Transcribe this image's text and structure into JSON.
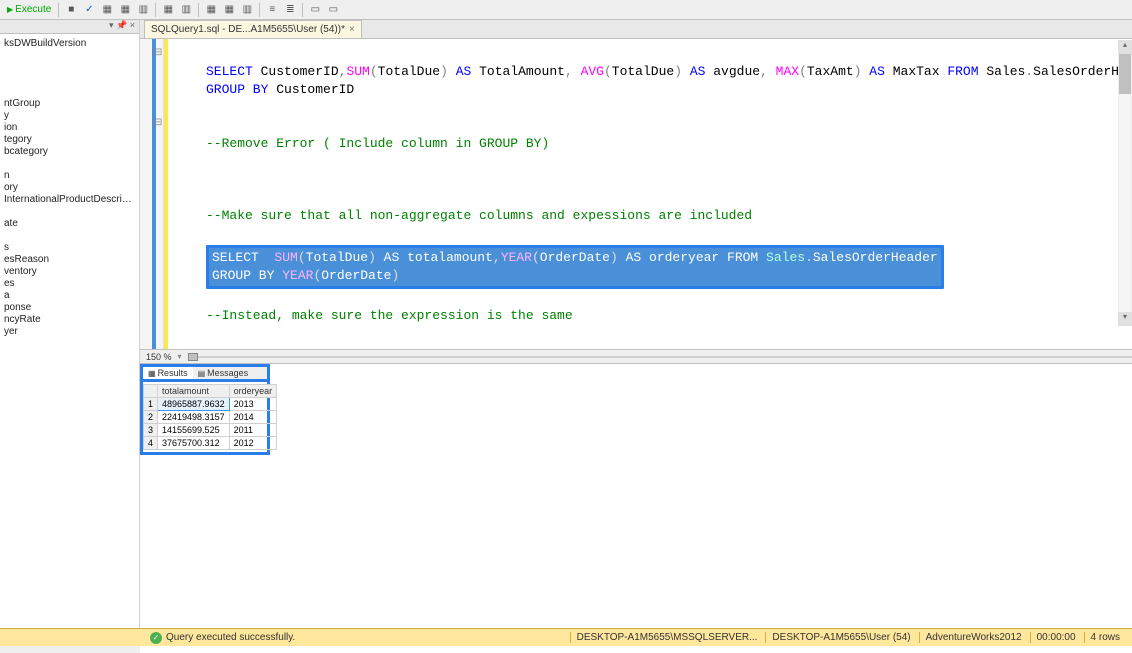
{
  "toolbar": {
    "execute_label": "Execute"
  },
  "sidebar": {
    "items": [
      "ksDWBuildVersion",
      "",
      "",
      "ntGroup",
      "y",
      "ion",
      "tegory",
      "bcategory",
      "",
      "n",
      "ory",
      "InternationalProductDescription",
      "",
      "ate",
      "",
      "s",
      "esReason",
      "ventory",
      "es",
      "a",
      "ponse",
      "ncyRate",
      "yer"
    ]
  },
  "tab": {
    "title": "SQLQuery1.sql - DE...A1M5655\\User (54))*",
    "close": "×"
  },
  "code": {
    "line1": {
      "select": "SELECT",
      "txt1": " CustomerID",
      "op1": ",",
      "sum": "SUM",
      "p1": "(",
      "t1": "TotalDue",
      "p2": ")",
      "as1": " AS ",
      "t2": "TotalAmount",
      "op2": ", ",
      "avg": "AVG",
      "p3": "(",
      "t3": "TotalDue",
      "p4": ")",
      "as2": " AS ",
      "t4": "avgdue",
      "op3": ", ",
      "max": "MAX",
      "p5": "(",
      "t5": "TaxAmt",
      "p6": ")",
      "as3": " AS ",
      "t6": "MaxTax ",
      "from": "FROM ",
      "tbl": "Sales",
      "dot": ".",
      "tbl2": "SalesOrderHeader"
    },
    "line2": {
      "group": "GROUP BY",
      "txt": " CustomerID"
    },
    "comment1": "--Remove Error ( Include column in GROUP BY)",
    "comment2": "--Make sure that all non-aggregate columns and expessions are included",
    "hl1": {
      "select": "SELECT  ",
      "sum": "SUM",
      "p1": "(",
      "t1": "TotalDue",
      "p2": ")",
      "as1": " AS ",
      "t2": "totalamount",
      "op": ",",
      "year": "YEAR",
      "p3": "(",
      "t3": "OrderDate",
      "p4": ")",
      "as2": " AS ",
      "t4": "orderyear ",
      "from": "FROM ",
      "tbl": "Sales",
      "dot": ".",
      "tbl2": "SalesOrderHeader"
    },
    "hl2": {
      "group": "GROUP BY ",
      "year": "YEAR",
      "p1": "(",
      "t1": "OrderDate",
      "p2": ")"
    },
    "comment3": "--Instead, make sure the expression is the same"
  },
  "zoom": "150 %",
  "results": {
    "tab_results": "Results",
    "tab_messages": "Messages",
    "columns": [
      "",
      "totalamount",
      "orderyear"
    ],
    "rows": [
      {
        "n": "1",
        "amt": "48965887.9632",
        "yr": "2013"
      },
      {
        "n": "2",
        "amt": "22419498.3157",
        "yr": "2014"
      },
      {
        "n": "3",
        "amt": "14155699.525",
        "yr": "2011"
      },
      {
        "n": "4",
        "amt": "37675700.312",
        "yr": "2012"
      }
    ]
  },
  "status": {
    "msg": "Query executed successfully.",
    "server": "DESKTOP-A1M5655\\MSSQLSERVER...",
    "user": "DESKTOP-A1M5655\\User (54)",
    "db": "AdventureWorks2012",
    "time": "00:00:00",
    "rows": "4 rows"
  }
}
